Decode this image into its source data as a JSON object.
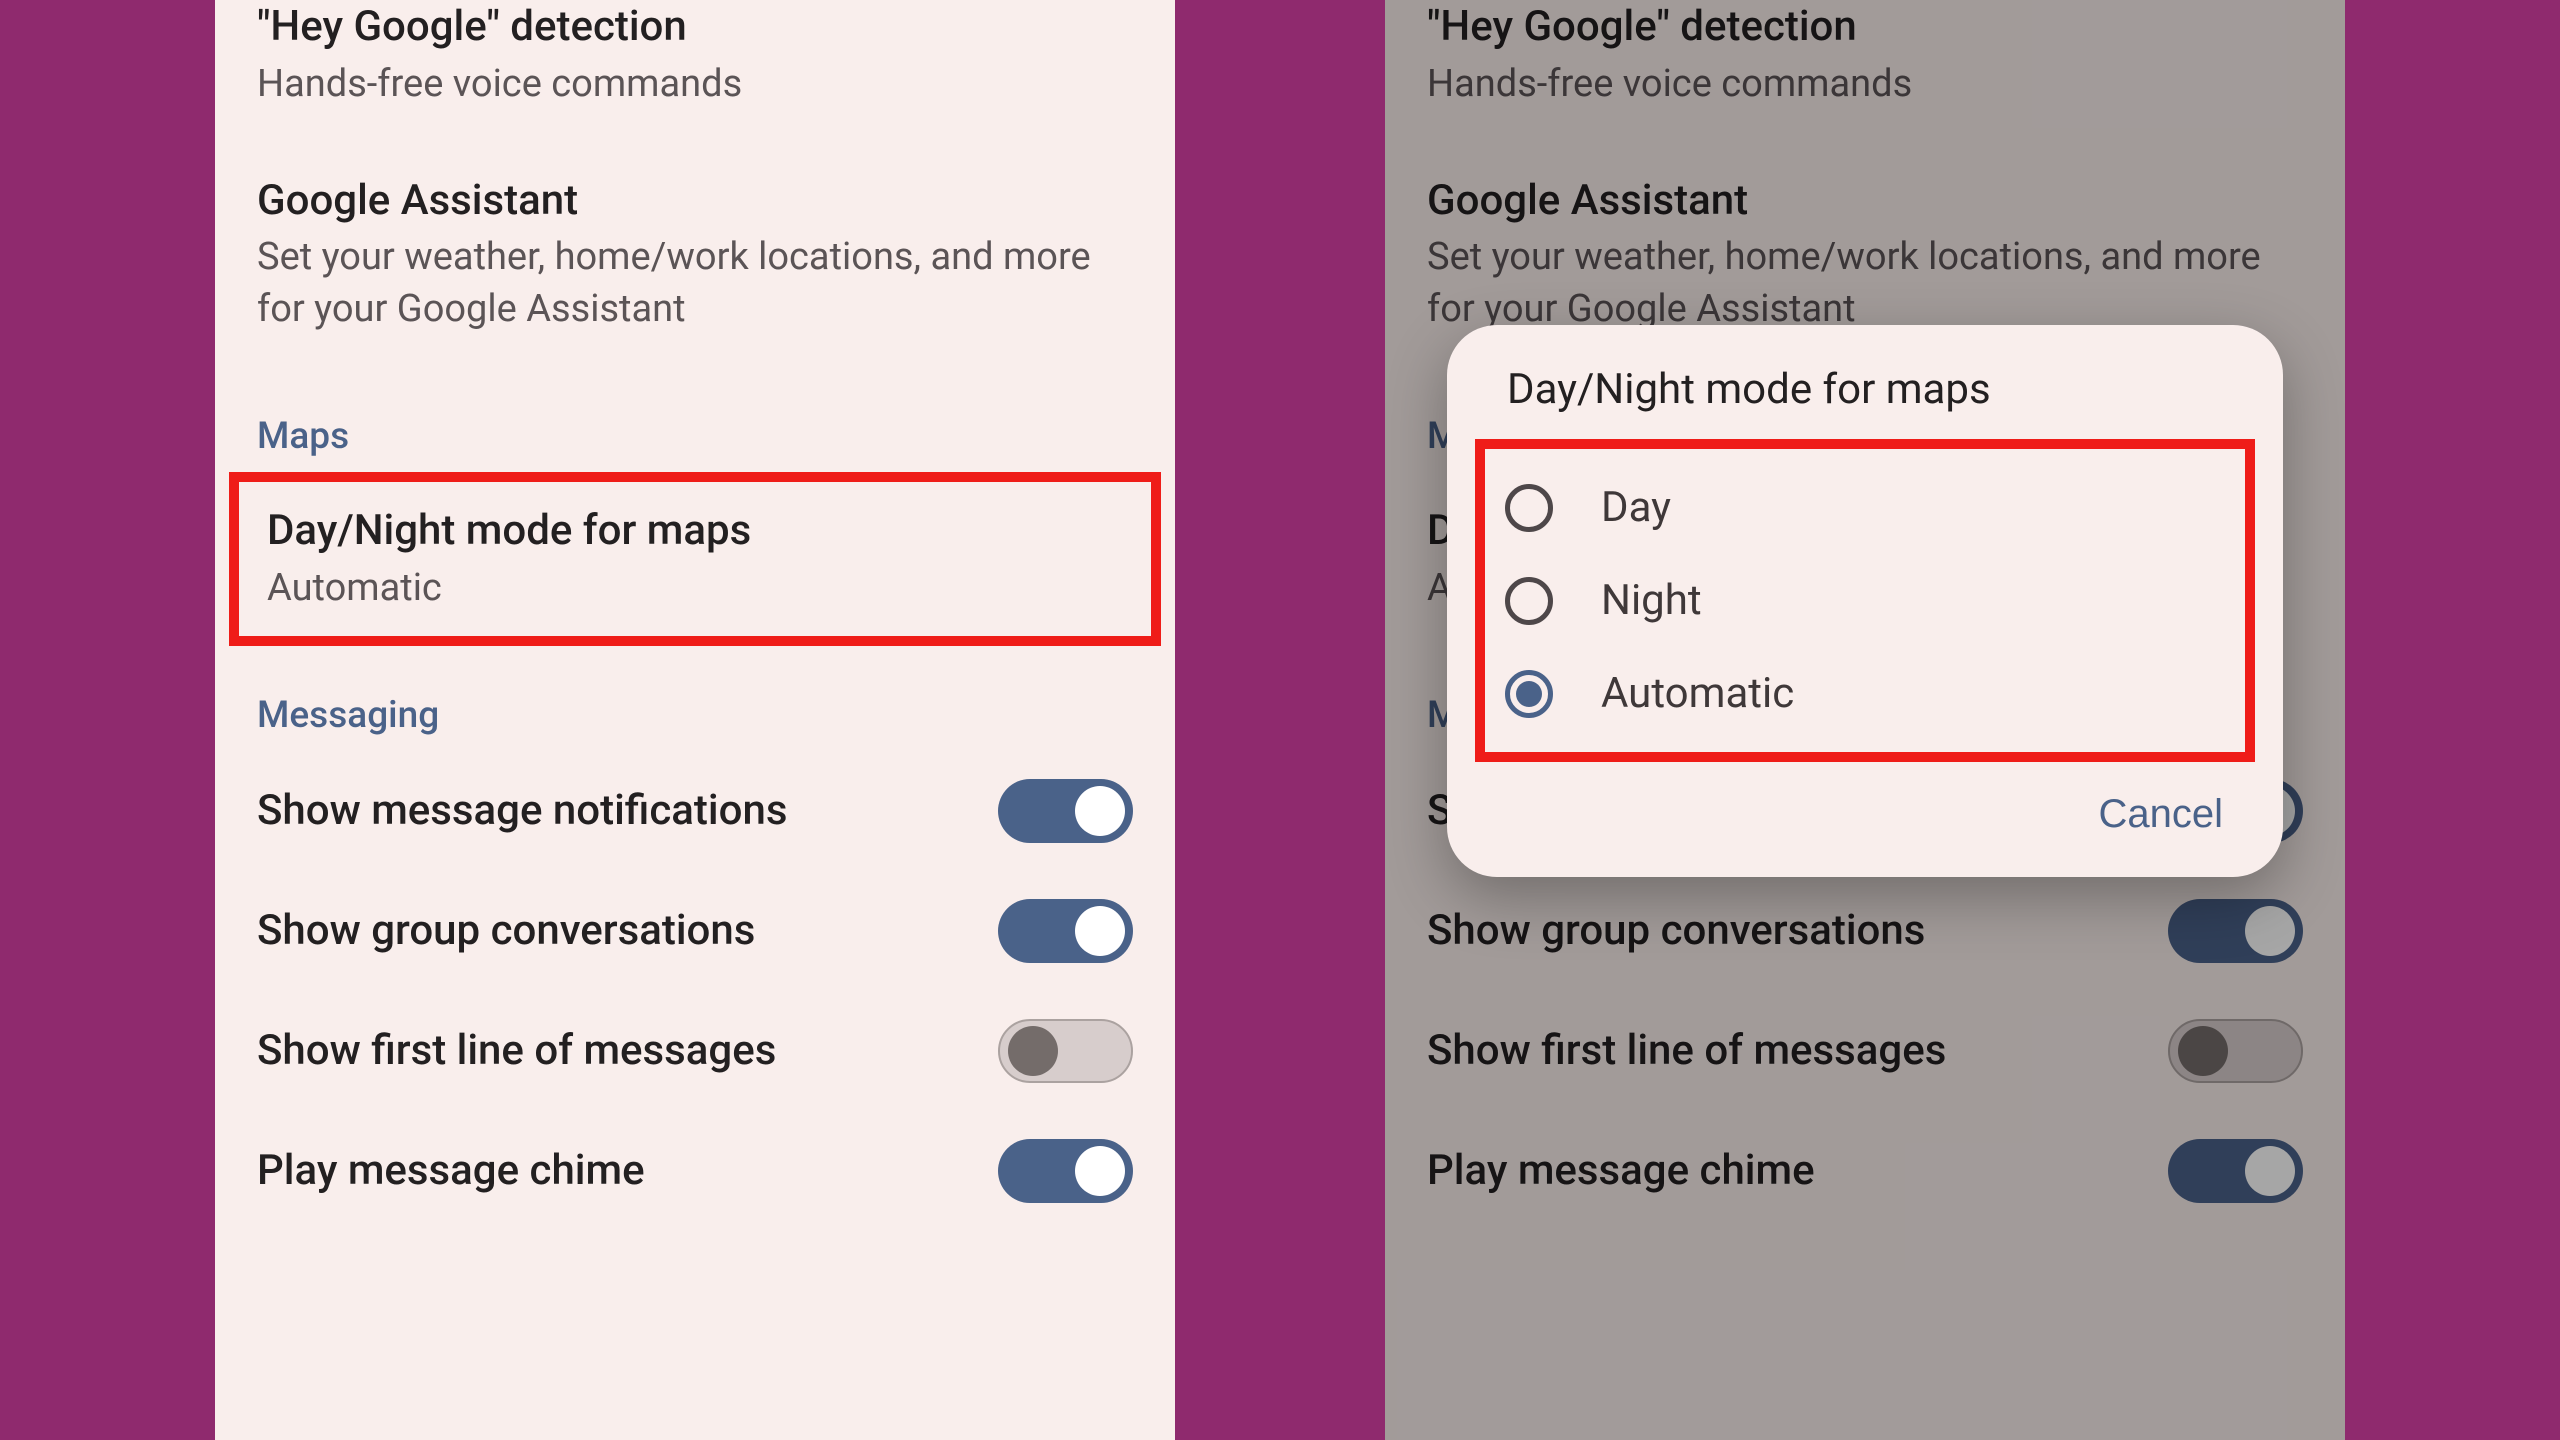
{
  "settings": {
    "hey_google": {
      "title": "\"Hey Google\" detection",
      "sub": "Hands-free voice commands"
    },
    "assistant": {
      "title": "Google Assistant",
      "sub": "Set your weather, home/work locations, and more for your Google Assistant"
    },
    "sections": {
      "maps": "Maps",
      "messaging": "Messaging"
    },
    "day_night": {
      "title": "Day/Night mode for maps",
      "value": "Automatic"
    },
    "toggles": {
      "notifications": {
        "label": "Show message notifications",
        "on": true
      },
      "group": {
        "label": "Show group conversations",
        "on": true
      },
      "first_line": {
        "label": "Show first line of messages",
        "on": false
      },
      "chime": {
        "label": "Play message chime",
        "on": true
      }
    }
  },
  "dialog": {
    "title": "Day/Night mode for maps",
    "options": {
      "day": "Day",
      "night": "Night",
      "automatic": "Automatic"
    },
    "selected": "automatic",
    "cancel": "Cancel"
  }
}
